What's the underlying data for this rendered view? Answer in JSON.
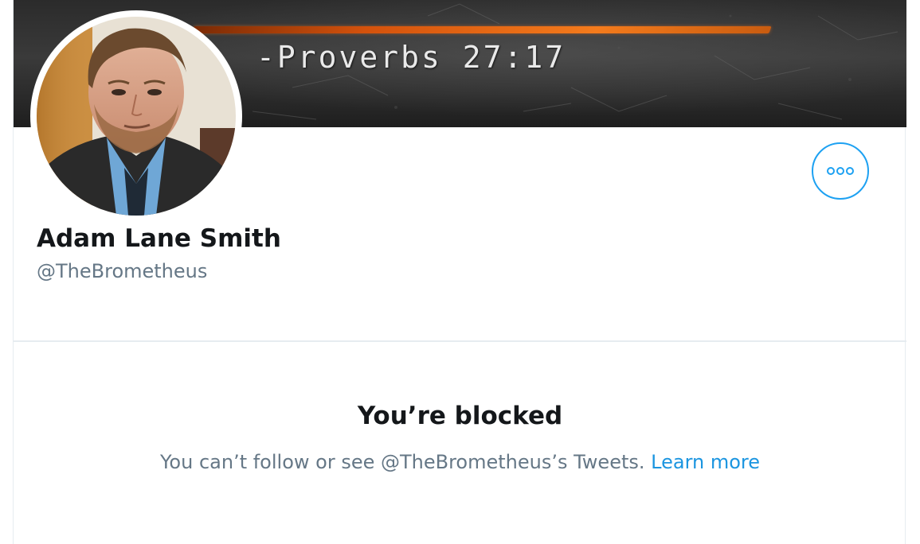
{
  "banner": {
    "quote_text": "-Proverbs 27:17"
  },
  "profile": {
    "display_name": "Adam Lane Smith",
    "handle": "@TheBrometheus",
    "avatar_alt": "Adam Lane Smith profile photo"
  },
  "actions": {
    "more_icon": "more-horizontal-icon"
  },
  "blocked": {
    "title": "You’re blocked",
    "message": "You can’t follow or see @TheBrometheus’s Tweets.",
    "link_label": "Learn more"
  },
  "colors": {
    "accent": "#1da1f2",
    "link": "#1b95e0",
    "primary_text": "#14171a",
    "secondary_text": "#657786",
    "border": "#e6ecf0"
  }
}
